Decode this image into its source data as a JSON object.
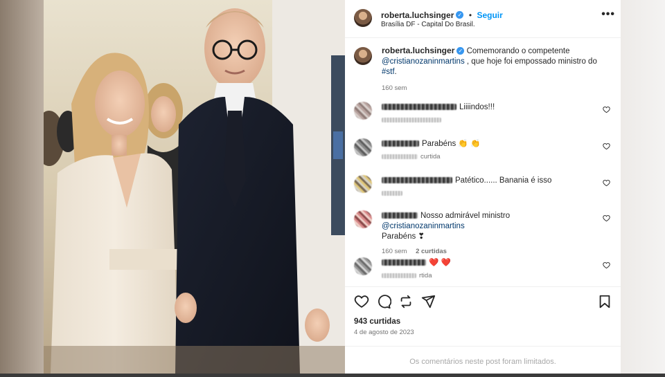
{
  "post": {
    "username": "roberta.luchsinger",
    "follow_label": "Seguir",
    "location": "Brasília DF - Capital Do Brasil.",
    "more_label": "•••"
  },
  "caption": {
    "username": "roberta.luchsinger",
    "text_1": "Comemorando o competente",
    "mention": "@cristianozaninmartins",
    "text_2": ", que hoje foi empossado ministro do",
    "hashtag": "#stf",
    "text_3": ".",
    "time": "160 sem"
  },
  "comments": [
    {
      "text": "Liiiindos!!!",
      "meta": ""
    },
    {
      "text": "Parabéns 👏 👏",
      "meta": "curtida"
    },
    {
      "text": "Patético...... Banania é isso",
      "meta": ""
    },
    {
      "text_1": "Nosso admirável ministro",
      "mention": "@cristianozaninmartins",
      "text_2": "Parabéns ❣",
      "time": "160 sem",
      "likes": "2 curtidas"
    },
    {
      "text": "❤️ ❤️",
      "meta": "rtida"
    }
  ],
  "stats": {
    "likes": "943 curtidas",
    "date": "4 de agosto de 2023"
  },
  "footer": {
    "limited_text": "Os comentários neste post foram limitados."
  },
  "colors": {
    "link": "#00376b",
    "follow": "#0095f6",
    "verified": "#3797f0",
    "heart": "#ed4956"
  }
}
